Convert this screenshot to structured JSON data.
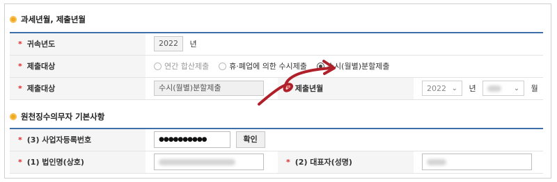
{
  "section1": {
    "title": "과세년월, 제출년월",
    "row_year": {
      "label": "귀속년도",
      "value": "2022",
      "unit": "년"
    },
    "row_target": {
      "label": "제출대상",
      "options": [
        "연간 합산제출",
        "휴·폐업에 의한 수시제출",
        "수시(월별)분할제출"
      ],
      "selected_index": 2
    },
    "row_target2": {
      "label": "제출대상",
      "value": "수시(월별)분할제출",
      "submit_label": "제출년월",
      "year_value": "2022",
      "year_unit": "년",
      "month_unit": "월"
    }
  },
  "section2": {
    "title": "원천징수의무자 기본사항",
    "row_bizno": {
      "label": "(3) 사업자등록번호",
      "value": "●●●●●●●●●●",
      "button": "확인"
    },
    "row_name": {
      "label": "(1) 법인명(상호)",
      "label2": "(2) 대표자(성명)"
    }
  },
  "required_mark": "*",
  "colors": {
    "accent": "#3e6fa8",
    "required": "#e02b2b",
    "bullet": "#f0a81e",
    "annotation_arrow": "#b0202a"
  },
  "icons": {
    "bullet": "orange-circle-bullet-icon",
    "arrow": "curved-arrow-annotation-icon",
    "select": "chevron-down-icon"
  }
}
